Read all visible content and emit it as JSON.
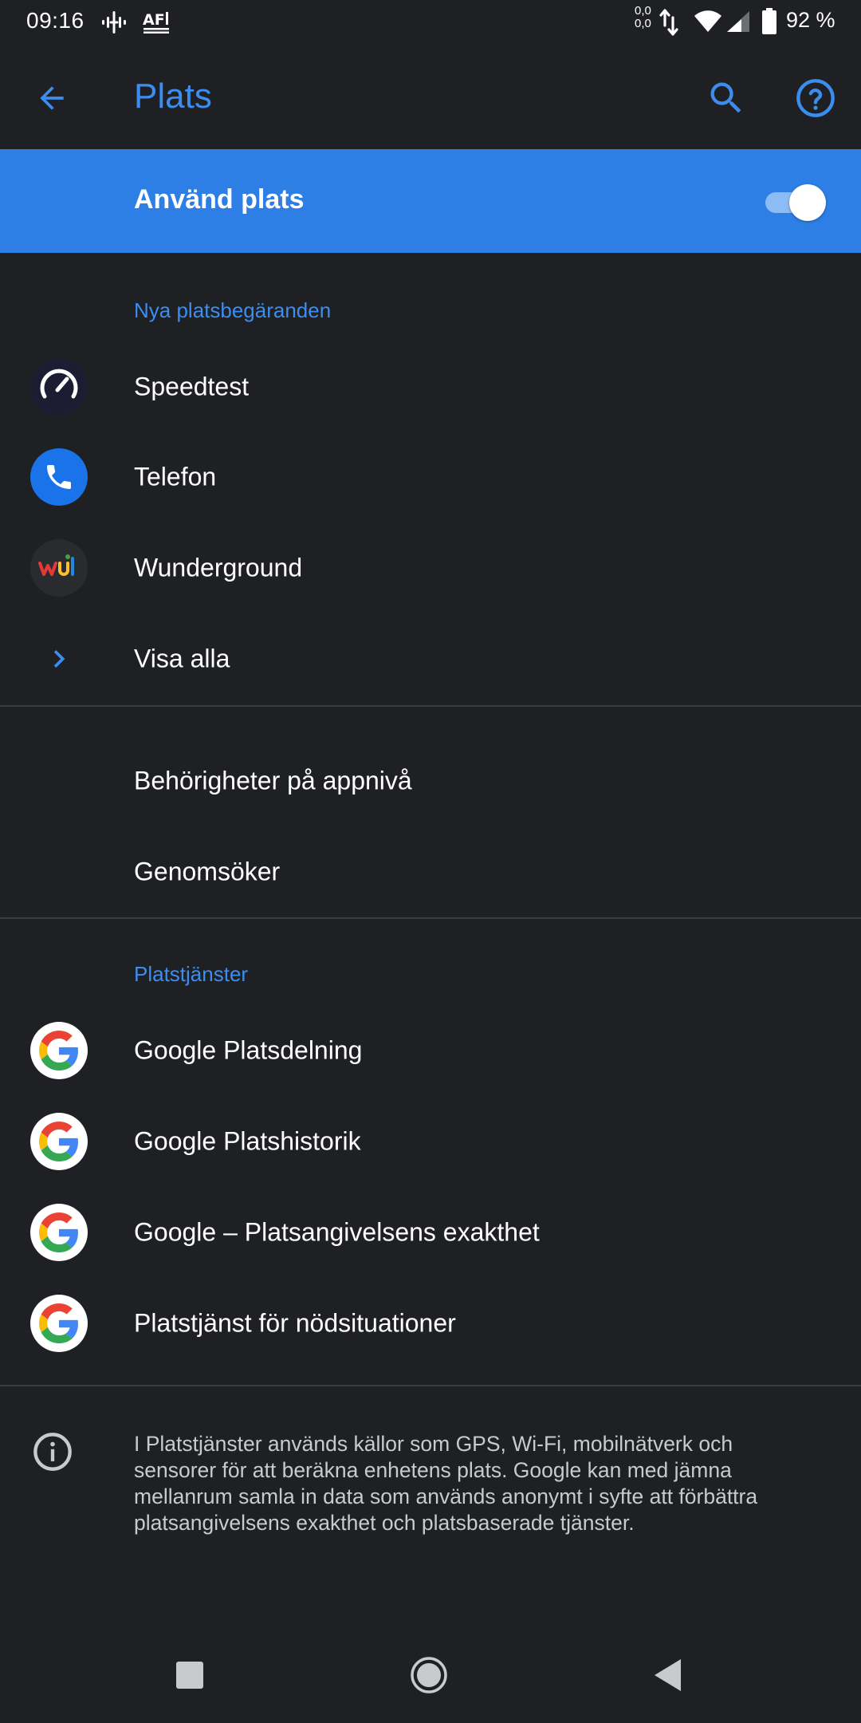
{
  "status_bar": {
    "time": "09:16",
    "net_speed_up": "0,0",
    "net_speed_down": "0,0",
    "battery_percent": "92 %",
    "icons": [
      "podcast-icon",
      "news-badge-icon",
      "data-transfer-icon",
      "wifi-icon",
      "cell-signal-icon",
      "battery-icon"
    ]
  },
  "app_bar": {
    "title": "Plats",
    "icons": [
      "back-arrow-icon",
      "search-icon",
      "help-icon"
    ]
  },
  "master_toggle": {
    "label": "Använd plats",
    "enabled": true
  },
  "recent_requests": {
    "header": "Nya platsbegäranden",
    "items": [
      {
        "label": "Speedtest",
        "icon": "speedtest-icon"
      },
      {
        "label": "Telefon",
        "icon": "phone-icon"
      },
      {
        "label": "Wunderground",
        "icon": "wunderground-icon"
      },
      {
        "label": "Visa alla",
        "icon": "chevron-right-icon"
      }
    ]
  },
  "permissions": {
    "items": [
      {
        "label": "Behörigheter på appnivå"
      },
      {
        "label": "Genomsöker"
      }
    ]
  },
  "location_services": {
    "header": "Platstjänster",
    "items": [
      {
        "label": "Google Platsdelning",
        "icon": "google-icon"
      },
      {
        "label": "Google Platshistorik",
        "icon": "google-icon"
      },
      {
        "label": "Google – Platsangivelsens exakthet",
        "icon": "google-icon"
      },
      {
        "label": "Platstjänst för nödsituationer",
        "icon": "google-icon"
      }
    ]
  },
  "info": {
    "icon": "info-icon",
    "text": "I Platstjänster används källor som GPS, Wi-Fi, mobilnätverk och sensorer för att beräkna enhetens plats. Google kan med jämna mellanrum samla in data som används anonymt i syfte att förbättra platsangivelsens exakthet och platsbaserade tjänster."
  },
  "nav_bar": {
    "icons": [
      "recents-square-icon",
      "home-circle-icon",
      "back-triangle-icon"
    ]
  },
  "colors": {
    "background": "#1f2024",
    "accent": "#3b8ef0",
    "master_bar": "#2d7fe6",
    "divider": "#3a3b40",
    "secondary_text": "#c9cacd"
  }
}
